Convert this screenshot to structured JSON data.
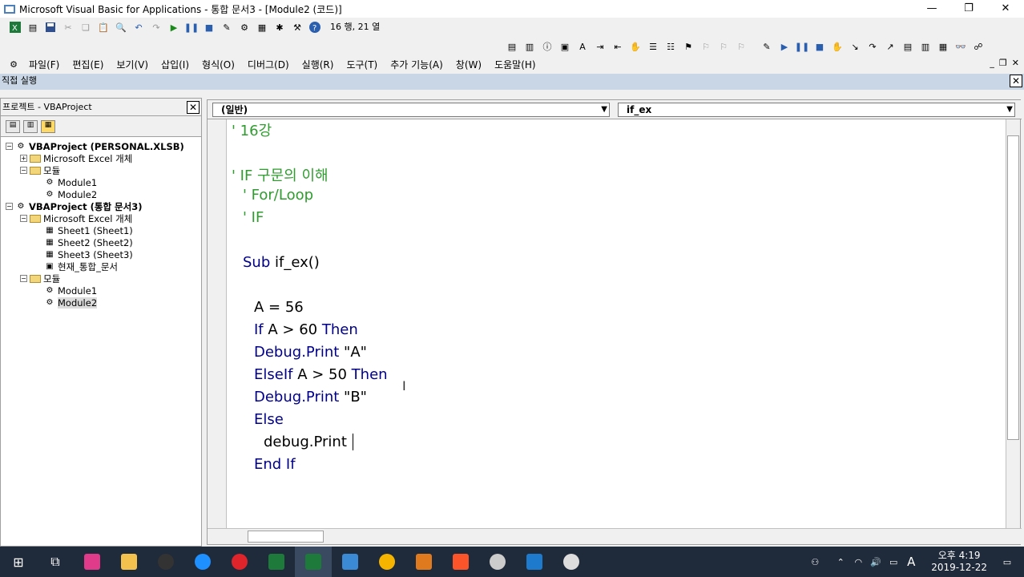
{
  "window": {
    "title": "Microsoft Visual Basic for Applications - 통합 문서3 - [Module2 (코드)]",
    "minimize": "—",
    "restore": "❐",
    "close": "✕"
  },
  "toolbar": {
    "position_text": "16 행, 21 열"
  },
  "menu": {
    "items": [
      "파일(F)",
      "편집(E)",
      "보기(V)",
      "삽입(I)",
      "형식(O)",
      "디버그(D)",
      "실행(R)",
      "도구(T)",
      "추가 기능(A)",
      "창(W)",
      "도움말(H)"
    ]
  },
  "immediate": {
    "label": "직접 실행"
  },
  "project": {
    "title": "프로젝트 - VBAProject",
    "tree": [
      {
        "label": "VBAProject (PERSONAL.XLSB)",
        "level": 0,
        "bold": true,
        "exp": "−"
      },
      {
        "label": "Microsoft Excel 개체",
        "level": 1,
        "exp": "+",
        "icon": "folder"
      },
      {
        "label": "모듈",
        "level": 1,
        "exp": "−",
        "icon": "folder"
      },
      {
        "label": "Module1",
        "level": 2,
        "icon": "module"
      },
      {
        "label": "Module2",
        "level": 2,
        "icon": "module"
      },
      {
        "label": "VBAProject (통합 문서3)",
        "level": 0,
        "bold": true,
        "exp": "−"
      },
      {
        "label": "Microsoft Excel 개체",
        "level": 1,
        "exp": "−",
        "icon": "folder"
      },
      {
        "label": "Sheet1 (Sheet1)",
        "level": 2,
        "icon": "sheet"
      },
      {
        "label": "Sheet2 (Sheet2)",
        "level": 2,
        "icon": "sheet"
      },
      {
        "label": "Sheet3 (Sheet3)",
        "level": 2,
        "icon": "sheet"
      },
      {
        "label": "현재_통합_문서",
        "level": 2,
        "icon": "workbook"
      },
      {
        "label": "모듈",
        "level": 1,
        "exp": "−",
        "icon": "folder"
      },
      {
        "label": "Module1",
        "level": 2,
        "icon": "module"
      },
      {
        "label": "Module2",
        "level": 2,
        "icon": "module",
        "selected": true
      }
    ]
  },
  "code": {
    "object_combo": "(일반)",
    "proc_combo": "if_ex",
    "lines": [
      {
        "text": "' 16강",
        "kind": "cmt",
        "indent": 0
      },
      {
        "text": "' IF 구문의 이해",
        "kind": "cmt",
        "indent": 0
      },
      {
        "text": "' For/Loop",
        "kind": "cmt",
        "indent": 1
      },
      {
        "text": "' IF",
        "kind": "cmt",
        "indent": 1
      },
      {
        "text": "Sub if_ex()",
        "kind": "sub",
        "indent": 1
      },
      {
        "text": "A = 56",
        "kind": "plain",
        "indent": 2
      },
      {
        "text": "If A > 60 Then",
        "kind": "if",
        "indent": 2
      },
      {
        "text": "Debug.Print \"A\"",
        "kind": "dbg",
        "indent": 2
      },
      {
        "text": "ElseIf A > 50 Then",
        "kind": "elseif",
        "indent": 2
      },
      {
        "text": "Debug.Print \"B\"",
        "kind": "dbg",
        "indent": 2
      },
      {
        "text": "Else",
        "kind": "else",
        "indent": 2
      },
      {
        "text": "debug.Print ",
        "kind": "plain",
        "indent": 3
      },
      {
        "text": "End If",
        "kind": "endif",
        "indent": 2
      }
    ]
  },
  "taskbar": {
    "time": "오후 4:19",
    "date": "2019-12-22",
    "ime": "A"
  }
}
